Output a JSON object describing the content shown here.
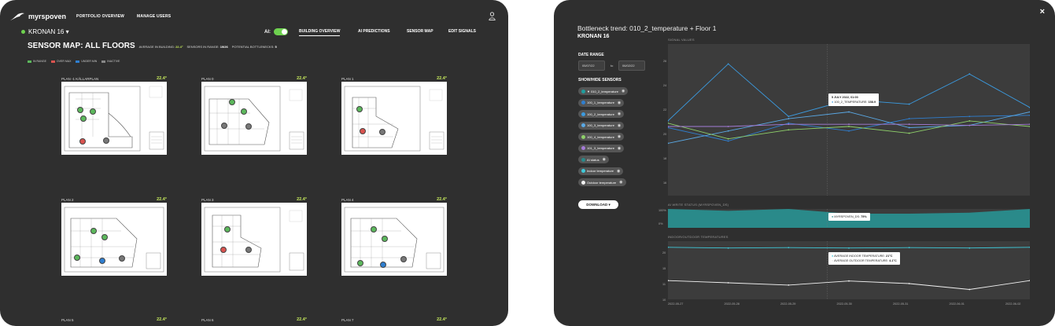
{
  "app": {
    "logo_text": "myrspoven",
    "user_icon": "user-icon"
  },
  "nav": {
    "portfolio": "PORTFOLIO OVERVIEW",
    "users": "MANAGE USERS"
  },
  "site": {
    "name": "KRONAN 16 ▾",
    "status_color": "#6ed14f"
  },
  "ai_toggle": {
    "label": "AI:",
    "on": true
  },
  "tabs": [
    {
      "label": "BUILDING OVERVIEW",
      "active": true
    },
    {
      "label": "AI PREDICTIONS",
      "active": false
    },
    {
      "label": "SENSOR MAP",
      "active": false
    },
    {
      "label": "EDIT SIGNALS",
      "active": false
    }
  ],
  "header": {
    "title": "SENSOR MAP: ALL FLOORS",
    "avg_label": "AVERAGE IN BUILDING:",
    "avg_value": "22.4°",
    "range_label": "SENSORS IN RANGE:",
    "range_value": "19/26",
    "bottleneck_label": "POTENTIAL BOTTLENECKS:",
    "bottleneck_value": "5"
  },
  "legend": [
    {
      "label": "IN RANGE",
      "color": "#5cb85c"
    },
    {
      "label": "OVER MAX",
      "color": "#d9534f"
    },
    {
      "label": "UNDER MIN",
      "color": "#2f7fd1"
    },
    {
      "label": "INACTIVE",
      "color": "#888888"
    }
  ],
  "plans": [
    {
      "name": "PLAN -1 KÄLLARPLAN",
      "temp": "22.4°"
    },
    {
      "name": "PLAN 0",
      "temp": "22.4°"
    },
    {
      "name": "PLAN 1",
      "temp": "22.4°"
    },
    {
      "name": "PLAN 2",
      "temp": "22.4°"
    },
    {
      "name": "PLAN 3",
      "temp": "22.4°"
    },
    {
      "name": "PLAN 4",
      "temp": "22.4°"
    },
    {
      "name": "PLAN 5",
      "temp": "22.4°"
    },
    {
      "name": "PLAN 6",
      "temp": "22.4°"
    },
    {
      "name": "PLAN 7",
      "temp": "22.4°"
    }
  ],
  "detail": {
    "close": "×",
    "title": "Bottleneck trend: 010_2_temperature + Floor 1",
    "subtitle": "KRONAN 16",
    "date_range_label": "DATE RANGE",
    "date_from": "05/07/22",
    "date_to_label": "to",
    "date_to": "06/02/22",
    "sensors_label": "SHOW/HIDE SENSORS",
    "download": "DOWNLOAD ▾",
    "sensors": [
      {
        "label": "▼ 010_2_temperature",
        "color": "#1f9e9e"
      },
      {
        "label": "100_1_temperature",
        "color": "#2f7fd1"
      },
      {
        "label": "100_2_temperature",
        "color": "#3b9be0"
      },
      {
        "label": "100_3_temperature",
        "color": "#5aa9e6"
      },
      {
        "label": "100_4_temperature",
        "color": "#8fd16a"
      },
      {
        "label": "101_3_temperature",
        "color": "#a57bd8"
      },
      {
        "label": "AI status",
        "color": "#2a8a8a"
      },
      {
        "label": "Indoor temperature",
        "color": "#3fc9d9"
      },
      {
        "label": "Outdoor temperature",
        "color": "#f2f2f2"
      }
    ],
    "signal_values_label": "SIGNAL VALUES",
    "ai_status_label": "AI WRITE STATUS (MYRSPOVEN_DS)",
    "temps_label": "INDOOR/OUTDOOR TEMPERATURES",
    "tooltip_signal": {
      "date": "5 JULY 2022, 01:00",
      "series": "100_2_TEMPERATURE:",
      "value": "158.9"
    },
    "tooltip_ai": {
      "series": "MYRSPOVEN_DS:",
      "value": "75%"
    },
    "tooltip_temps": {
      "indoor_label": "AVERAGE INDOOR TEMPERATURE:",
      "indoor_value": "21°C",
      "outdoor_label": "AVERAGE OUTDOOR TEMPERATURE:",
      "outdoor_value": "4.1°C"
    }
  },
  "chart_data": [
    {
      "type": "line",
      "title": "SIGNAL VALUES",
      "ylim": [
        14,
        27
      ],
      "yticks": [
        "26",
        "24",
        "22",
        "20",
        "18",
        "16"
      ],
      "x": [
        "2022-05-27",
        "2022-05-28",
        "2022-05-29",
        "2022-05-30",
        "2022-05-31",
        "2022-06-01",
        "2022-06-02"
      ],
      "series": [
        {
          "name": "100_1_temperature",
          "color": "#2f7fd1",
          "values": [
            19.8,
            18.6,
            20.2,
            19.5,
            20.6,
            20.8,
            20.9
          ]
        },
        {
          "name": "100_2_temperature",
          "color": "#3b9be0",
          "values": [
            20.4,
            25.5,
            20.8,
            22.3,
            21.9,
            24.6,
            21.6
          ]
        },
        {
          "name": "100_3_temperature",
          "color": "#5aa9e6",
          "values": [
            18.4,
            19.5,
            20.6,
            21.2,
            19.8,
            20.0,
            21.2
          ]
        },
        {
          "name": "100_4_temperature",
          "color": "#8fd16a",
          "values": [
            20.2,
            18.8,
            19.6,
            19.9,
            19.3,
            20.4,
            19.9
          ]
        },
        {
          "name": "101_3_temperature",
          "color": "#a57bd8",
          "values": [
            19.9,
            19.9,
            20.1,
            20.1,
            20.1,
            20.0,
            20.1
          ]
        }
      ]
    },
    {
      "type": "area",
      "title": "AI WRITE STATUS (MYRSPOVEN_DS)",
      "ylim": [
        0,
        100
      ],
      "yticks": [
        "100%",
        "0%"
      ],
      "series": [
        {
          "name": "MYRSPOVEN_DS",
          "color": "#2a8a8a",
          "values": [
            100,
            90,
            100,
            75,
            75,
            80,
            100
          ]
        }
      ]
    },
    {
      "type": "line",
      "title": "INDOOR/OUTDOOR TEMPERATURES",
      "ylim": [
        8,
        22
      ],
      "yticks": [
        "20",
        "15",
        "11",
        "10"
      ],
      "x": [
        "2022-05-27",
        "2022-05-28",
        "2022-05-29",
        "2022-05-30",
        "2022-05-31",
        "2022-06-01",
        "2022-06-02"
      ],
      "series": [
        {
          "name": "Indoor temperature",
          "color": "#3fc9d9",
          "values": [
            21.2,
            21.0,
            21.1,
            21.0,
            21.1,
            21.0,
            21.2
          ]
        },
        {
          "name": "Outdoor temperature",
          "color": "#f2f2f2",
          "values": [
            12.2,
            11.6,
            11.0,
            12.1,
            11.4,
            9.8,
            12.2
          ]
        }
      ]
    }
  ]
}
